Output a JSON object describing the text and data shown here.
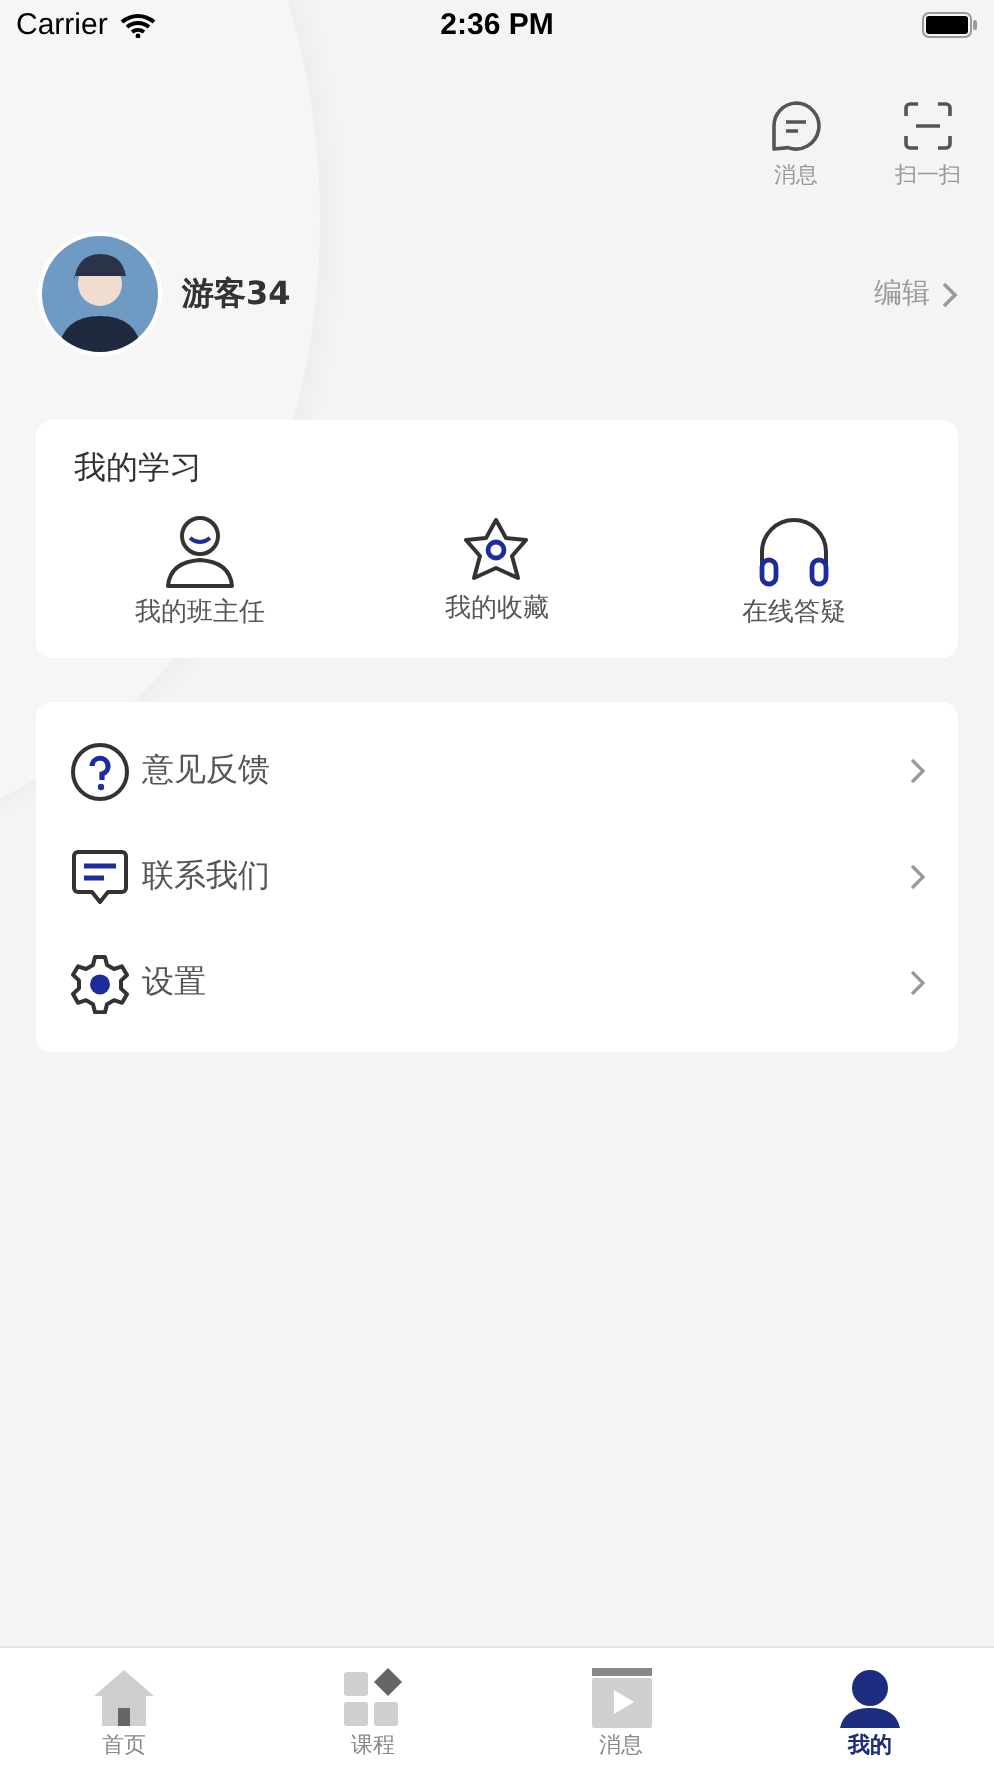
{
  "status_bar": {
    "carrier": "Carrier",
    "time": "2:36 PM"
  },
  "header_actions": [
    {
      "label": "消息"
    },
    {
      "label": "扫一扫"
    }
  ],
  "profile": {
    "name": "游客34",
    "edit": "编辑"
  },
  "my_learning": {
    "title": "我的学习",
    "items": [
      {
        "label": "我的班主任"
      },
      {
        "label": "我的收藏"
      },
      {
        "label": "在线答疑"
      }
    ]
  },
  "menu": [
    {
      "label": "意见反馈"
    },
    {
      "label": "联系我们"
    },
    {
      "label": "设置"
    }
  ],
  "tab_bar": [
    {
      "label": "首页",
      "selected": false
    },
    {
      "label": "课程",
      "selected": false
    },
    {
      "label": "消息",
      "selected": false
    },
    {
      "label": "我的",
      "selected": true
    }
  ]
}
